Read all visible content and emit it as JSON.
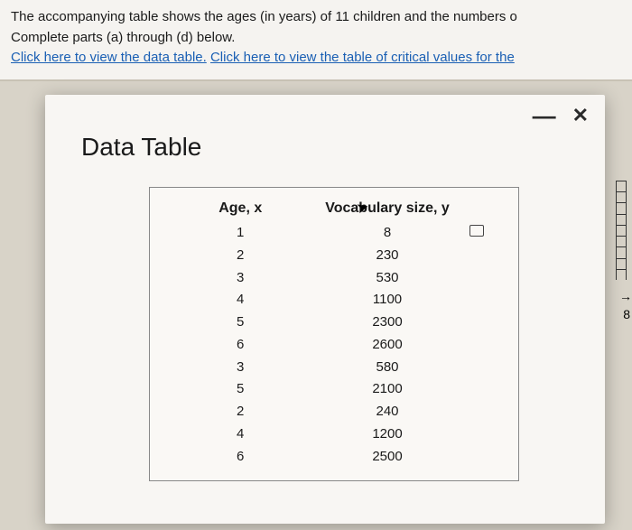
{
  "problem": {
    "line1": "The accompanying table shows the ages (in years) of 11 children and the numbers o",
    "line2": "Complete parts (a) through (d) below.",
    "link1": "Click here to view the data table.",
    "link2": "Click here to view the table of critical values for the"
  },
  "modal": {
    "title": "Data Table",
    "minimize": "—",
    "close": "✕"
  },
  "table": {
    "header_x": "Age, x",
    "header_y": "Vocabulary size, y",
    "rows": [
      {
        "x": "1",
        "y": "8"
      },
      {
        "x": "2",
        "y": "230"
      },
      {
        "x": "3",
        "y": "530"
      },
      {
        "x": "4",
        "y": "1100"
      },
      {
        "x": "5",
        "y": "2300"
      },
      {
        "x": "6",
        "y": "2600"
      },
      {
        "x": "3",
        "y": "580"
      },
      {
        "x": "5",
        "y": "2100"
      },
      {
        "x": "2",
        "y": "240"
      },
      {
        "x": "4",
        "y": "1200"
      },
      {
        "x": "6",
        "y": "2500"
      }
    ]
  },
  "edge": {
    "eight": "8"
  },
  "chart_data": {
    "type": "table",
    "title": "Data Table",
    "columns": [
      "Age, x",
      "Vocabulary size, y"
    ],
    "data": [
      [
        1,
        8
      ],
      [
        2,
        230
      ],
      [
        3,
        530
      ],
      [
        4,
        1100
      ],
      [
        5,
        2300
      ],
      [
        6,
        2600
      ],
      [
        3,
        580
      ],
      [
        5,
        2100
      ],
      [
        2,
        240
      ],
      [
        4,
        1200
      ],
      [
        6,
        2500
      ]
    ]
  }
}
